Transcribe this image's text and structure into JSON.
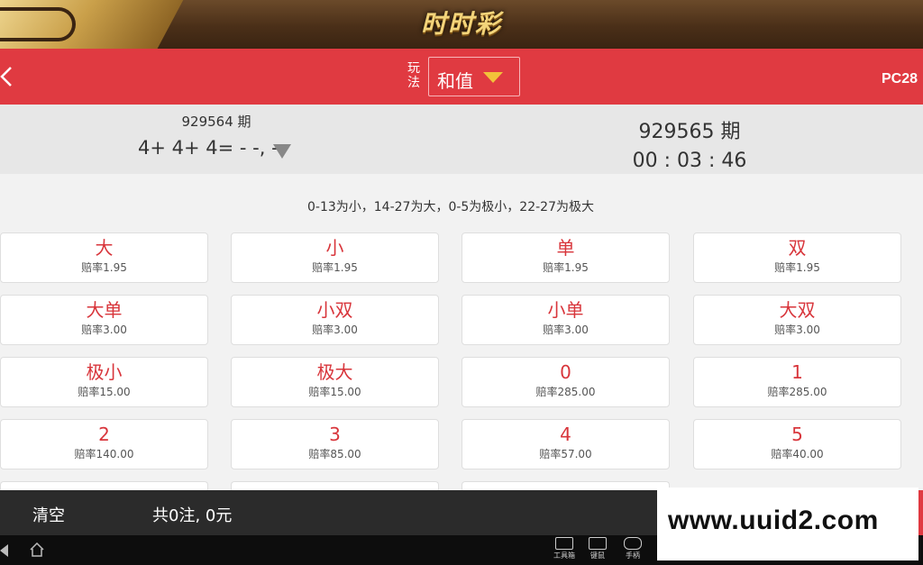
{
  "banner": {
    "title": "时时彩"
  },
  "header": {
    "play_label": "玩法",
    "play_value": "和值",
    "lottery": "PC28"
  },
  "draw": {
    "prev_issue": "929564 期",
    "prev_result": "4+ 4+ 4= - -, -",
    "current_issue": "929565 期",
    "countdown": "00 : 03 : 46"
  },
  "rules_text": "0-13为小，14-27为大，0-5为极小，22-27为极大",
  "bets": [
    {
      "name": "大",
      "odds": "赔率1.95"
    },
    {
      "name": "小",
      "odds": "赔率1.95"
    },
    {
      "name": "单",
      "odds": "赔率1.95"
    },
    {
      "name": "双",
      "odds": "赔率1.95"
    },
    {
      "name": "大单",
      "odds": "赔率3.00"
    },
    {
      "name": "小双",
      "odds": "赔率3.00"
    },
    {
      "name": "小单",
      "odds": "赔率3.00"
    },
    {
      "name": "大双",
      "odds": "赔率3.00"
    },
    {
      "name": "极小",
      "odds": "赔率15.00"
    },
    {
      "name": "极大",
      "odds": "赔率15.00"
    },
    {
      "name": "0",
      "odds": "赔率285.00"
    },
    {
      "name": "1",
      "odds": "赔率285.00"
    },
    {
      "name": "2",
      "odds": "赔率140.00"
    },
    {
      "name": "3",
      "odds": "赔率85.00"
    },
    {
      "name": "4",
      "odds": "赔率57.00"
    },
    {
      "name": "5",
      "odds": "赔率40.00"
    }
  ],
  "bottom": {
    "clear_label": "清空",
    "total_text": "共0注, 0元"
  },
  "sysnav": {
    "tools": [
      {
        "label": "工具箱",
        "icon": "toolbox-icon"
      },
      {
        "label": "键鼠",
        "icon": "keyboard-icon"
      },
      {
        "label": "手柄",
        "icon": "gamepad-icon"
      }
    ]
  },
  "watermark": "www.uuid2.com",
  "colors": {
    "accent": "#e03a41",
    "bet_text": "#d8353b",
    "dropdown_arrow": "#f2c23a"
  }
}
